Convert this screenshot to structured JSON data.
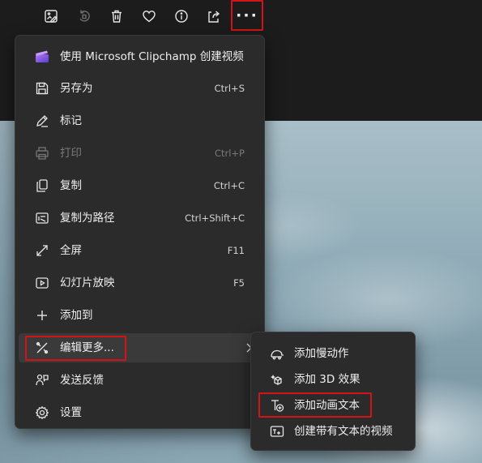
{
  "toolbar": {
    "icons": [
      "edit-image-icon",
      "rotate-icon",
      "delete-icon",
      "favorite-icon",
      "info-icon",
      "share-icon",
      "more-options-icon"
    ],
    "more_label": "···"
  },
  "menu": {
    "items": [
      {
        "icon": "clipchamp-icon",
        "label": "使用 Microsoft Clipchamp 创建视频",
        "shortcut": ""
      },
      {
        "icon": "save-icon",
        "label": "另存为",
        "shortcut": "Ctrl+S"
      },
      {
        "icon": "mark-icon",
        "label": "标记",
        "shortcut": ""
      },
      {
        "icon": "print-icon",
        "label": "打印",
        "shortcut": "Ctrl+P",
        "disabled": true
      },
      {
        "icon": "copy-icon",
        "label": "复制",
        "shortcut": "Ctrl+C"
      },
      {
        "icon": "copy-path-icon",
        "label": "复制为路径",
        "shortcut": "Ctrl+Shift+C"
      },
      {
        "icon": "fullscreen-icon",
        "label": "全屏",
        "shortcut": "F11"
      },
      {
        "icon": "slideshow-icon",
        "label": "幻灯片放映",
        "shortcut": "F5"
      },
      {
        "icon": "add-icon",
        "label": "添加到",
        "shortcut": ""
      },
      {
        "icon": "edit-more-icon",
        "label": "编辑更多...",
        "shortcut": "",
        "has_submenu": true
      },
      {
        "icon": "feedback-icon",
        "label": "发送反馈",
        "shortcut": ""
      },
      {
        "icon": "settings-icon",
        "label": "设置",
        "shortcut": ""
      }
    ]
  },
  "submenu": {
    "items": [
      {
        "icon": "slow-motion-icon",
        "label": "添加慢动作"
      },
      {
        "icon": "3d-effects-icon",
        "label": "添加 3D 效果"
      },
      {
        "icon": "animated-text-icon",
        "label": "添加动画文本"
      },
      {
        "icon": "video-with-text-icon",
        "label": "创建带有文本的视频"
      }
    ]
  },
  "colors": {
    "highlight_box": "#d0141a",
    "menu_bg": "#2b2b2b",
    "bar_bg": "#1c1c1c"
  }
}
